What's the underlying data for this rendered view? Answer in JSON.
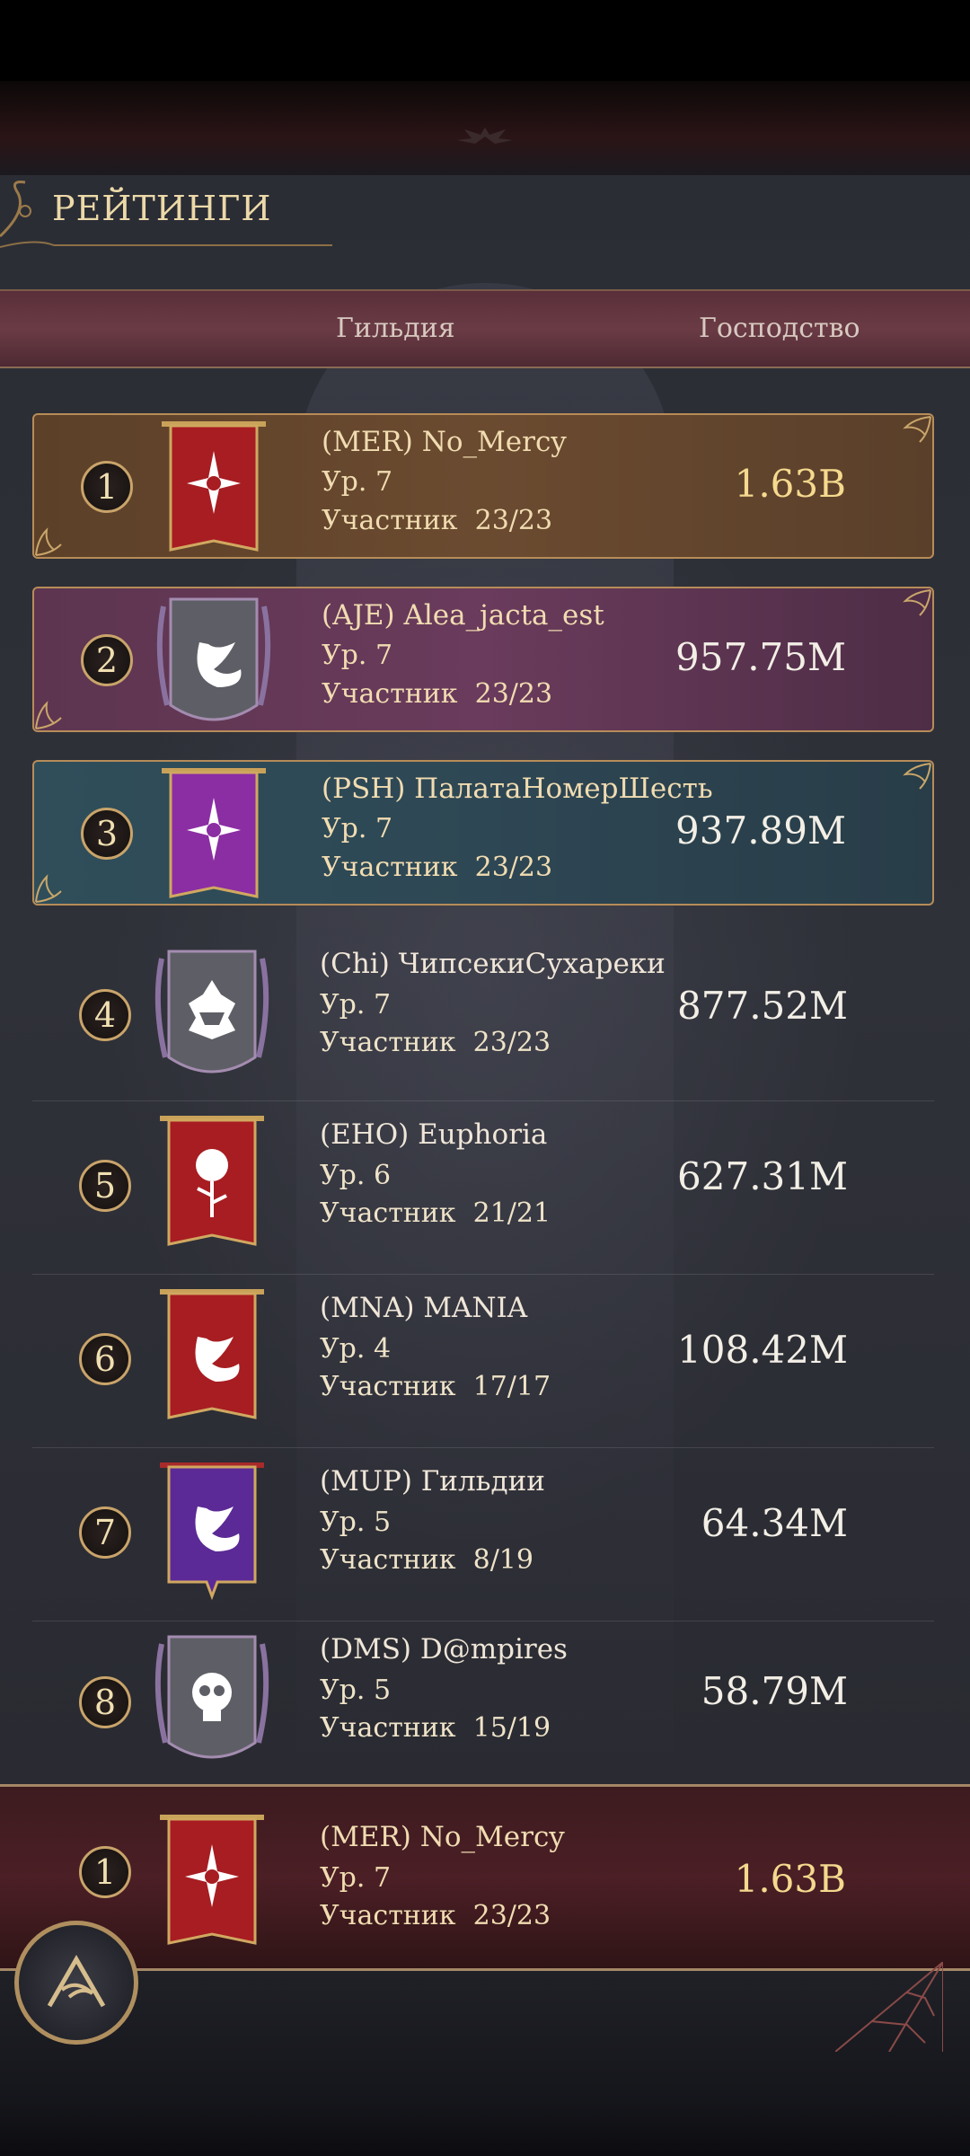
{
  "header": {
    "title": "РЕЙТИНГИ"
  },
  "columns": {
    "guild": "Гильдия",
    "dominance": "Господство"
  },
  "rows": [
    {
      "rank": "1",
      "name": "(MER) No_Mercy",
      "level": "Ур. 7",
      "members": "Участник  23/23",
      "dominance": "1.63B",
      "style": "gold",
      "banner_color": "#a71d22",
      "emblem": "eye-star-icon"
    },
    {
      "rank": "2",
      "name": "(AJE) Alea_jacta_est",
      "level": "Ур. 7",
      "members": "Участник  23/23",
      "dominance": "957.75M",
      "style": "purple",
      "banner_color": "#5e5f66",
      "emblem": "crescent-wing-icon"
    },
    {
      "rank": "3",
      "name": "(PSH) ПалатаНомерШесть",
      "level": "Ур. 7",
      "members": "Участник  23/23",
      "dominance": "937.89M",
      "style": "teal",
      "banner_color": "#8b2ea3",
      "emblem": "eye-star-icon"
    },
    {
      "rank": "4",
      "name": "(Chi) ЧипсекиСухареки",
      "level": "Ур. 7",
      "members": "Участник  23/23",
      "dominance": "877.52M",
      "style": "plain",
      "banner_color": "#5e5f66",
      "emblem": "monster-maw-icon"
    },
    {
      "rank": "5",
      "name": "(EHO) Euphoria",
      "level": "Ур. 6",
      "members": "Участник  21/21",
      "dominance": "627.31M",
      "style": "plain",
      "banner_color": "#a71d22",
      "emblem": "rose-icon"
    },
    {
      "rank": "6",
      "name": "(MNA) MANIA",
      "level": "Ур. 4",
      "members": "Участник  17/17",
      "dominance": "108.42M",
      "style": "plain",
      "banner_color": "#a71d22",
      "emblem": "crescent-wing-icon"
    },
    {
      "rank": "7",
      "name": "(MUP) Гильдии",
      "level": "Ур. 5",
      "members": "Участник  8/19",
      "dominance": "64.34M",
      "style": "plain",
      "banner_color": "#5b2a96",
      "emblem": "crescent-wing-icon"
    },
    {
      "rank": "8",
      "name": "(DMS) D@mpires",
      "level": "Ур. 5",
      "members": "Участник  15/19",
      "dominance": "58.79M",
      "style": "plain",
      "banner_color": "#5e5f66",
      "emblem": "skull-icon"
    }
  ],
  "my_guild": {
    "rank": "1",
    "name": "(MER) No_Mercy",
    "level": "Ур. 7",
    "members": "Участник  23/23",
    "dominance": "1.63B"
  }
}
